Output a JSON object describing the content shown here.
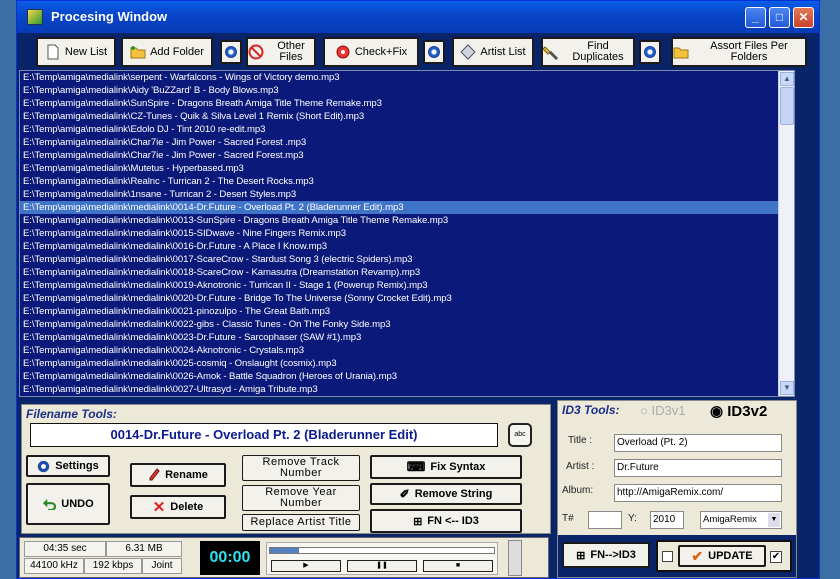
{
  "window": {
    "title": "Procesing Window"
  },
  "toolbar": {
    "new_list": "New List",
    "add_folder": "Add Folder",
    "other_files": "Other Files",
    "check_fix": "Check+Fix",
    "artist_list": "Artist List",
    "find_duplicates": "Find Duplicates",
    "assort_files": "Assort Files Per Folders"
  },
  "files": [
    "E:\\Temp\\amiga\\medialink\\serpent - Warfalcons - Wings of Victory demo.mp3",
    "E:\\Temp\\amiga\\medialink\\Aidy 'BuZZard' B - Body Blows.mp3",
    "E:\\Temp\\amiga\\medialink\\SunSpire - Dragons Breath Amiga Title Theme Remake.mp3",
    "E:\\Temp\\amiga\\medialink\\CZ-Tunes - Quik & Silva Level 1 Remix (Short Edit).mp3",
    "E:\\Temp\\amiga\\medialink\\Edolo DJ - Tint 2010 re-edit.mp3",
    "E:\\Temp\\amiga\\medialink\\Char7ie - Jim Power - Sacred Forest .mp3",
    "E:\\Temp\\amiga\\medialink\\Char7ie - Jim Power - Sacred Forest.mp3",
    "E:\\Temp\\amiga\\medialink\\Mutetus - Hyperbased.mp3",
    "E:\\Temp\\amiga\\medialink\\Realnc - Turrican 2 - The Desert Rocks.mp3",
    "E:\\Temp\\amiga\\medialink\\1nsane - Turrican 2 - Desert Styles.mp3",
    "E:\\Temp\\amiga\\medialink\\medialink\\0014-Dr.Future - Overload Pt. 2 (Bladerunner Edit).mp3",
    "E:\\Temp\\amiga\\medialink\\medialink\\0013-SunSpire - Dragons Breath Amiga Title Theme Remake.mp3",
    "E:\\Temp\\amiga\\medialink\\medialink\\0015-SIDwave - Nine Fingers Remix.mp3",
    "E:\\Temp\\amiga\\medialink\\medialink\\0016-Dr.Future - A Place I Know.mp3",
    "E:\\Temp\\amiga\\medialink\\medialink\\0017-ScareCrow - Stardust Song 3 (electric Spiders).mp3",
    "E:\\Temp\\amiga\\medialink\\medialink\\0018-ScareCrow - Kamasutra (Dreamstation Revamp).mp3",
    "E:\\Temp\\amiga\\medialink\\medialink\\0019-Aknotronic - Turrican II - Stage 1 (Powerup Remix).mp3",
    "E:\\Temp\\amiga\\medialink\\medialink\\0020-Dr.Future - Bridge To The Universe (Sonny Crocket Edit).mp3",
    "E:\\Temp\\amiga\\medialink\\medialink\\0021-pinozulpo - The Great Bath.mp3",
    "E:\\Temp\\amiga\\medialink\\medialink\\0022-gibs - Classic Tunes - On The Fonky Side.mp3",
    "E:\\Temp\\amiga\\medialink\\medialink\\0023-Dr.Future - Sarcophaser (SAW #1).mp3",
    "E:\\Temp\\amiga\\medialink\\medialink\\0024-Aknotronic - Crystals.mp3",
    "E:\\Temp\\amiga\\medialink\\medialink\\0025-cosmiq - Onslaught (cosmix).mp3",
    "E:\\Temp\\amiga\\medialink\\medialink\\0026-Amok - Battle Squadron (Heroes of Urania).mp3",
    "E:\\Temp\\amiga\\medialink\\medialink\\0027-Ultrasyd - Amiga Tribute.mp3"
  ],
  "selected_index": 10,
  "filename_tools": {
    "label": "Filename Tools:",
    "current": "0014-Dr.Future - Overload Pt. 2 (Bladerunner Edit)",
    "abc": "abc"
  },
  "buttons": {
    "settings": "Settings",
    "undo": "UNDO",
    "rename": "Rename",
    "delete": "Delete",
    "remove_track": "Remove Track Number",
    "remove_year": "Remove Year Number",
    "replace_artist": "Replace Artist Title",
    "fix_syntax": "Fix Syntax",
    "remove_string": "Remove String",
    "fn_id3": "FN <-- ID3",
    "id3_fn": "FN-->ID3",
    "update": "UPDATE"
  },
  "id3": {
    "label": "ID3 Tools:",
    "v1": "ID3v1",
    "v2": "ID3v2",
    "title_label": "Title :",
    "title": "Overload (Pt. 2)",
    "artist_label": "Artist :",
    "artist": "Dr.Future",
    "album_label": "Album:",
    "album": "http://AmigaRemix.com/",
    "track_label": "T#",
    "track": "",
    "year_label": "Y:",
    "year": "2010",
    "genre": "AmigaRemix"
  },
  "status": {
    "duration": "04:35 sec",
    "size": "6.31 MB",
    "freq": "44100 kHz",
    "bitrate": "192 kbps",
    "mode": "Joint",
    "time": "00:00",
    "play": "▶",
    "pause": "❚❚",
    "stop": "■",
    "seek_fraction": 0.13
  }
}
